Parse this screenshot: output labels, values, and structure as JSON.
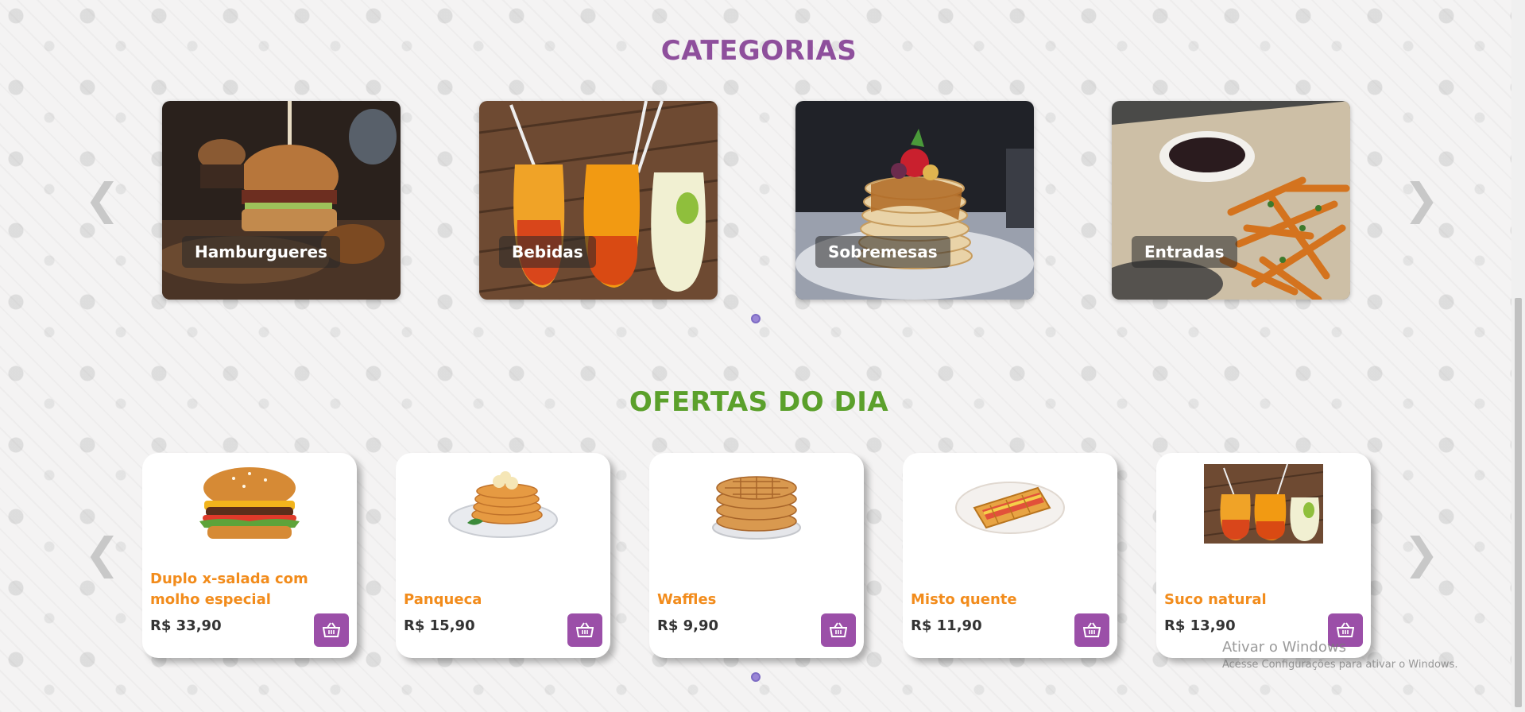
{
  "categories": {
    "title": "CATEGORIAS",
    "items": [
      {
        "label": "Hamburgueres"
      },
      {
        "label": "Bebidas"
      },
      {
        "label": "Sobremesas"
      },
      {
        "label": "Entradas"
      }
    ],
    "prev_arrow": "❮",
    "next_arrow": "❯"
  },
  "offers": {
    "title": "OFERTAS DO DIA",
    "items": [
      {
        "name": "Duplo x-salada com molho especial",
        "price": "R$ 33,90"
      },
      {
        "name": "Panqueca",
        "price": "R$ 15,90"
      },
      {
        "name": "Waffles",
        "price": "R$ 9,90"
      },
      {
        "name": "Misto quente",
        "price": "R$ 11,90"
      },
      {
        "name": "Suco natural",
        "price": "R$ 13,90"
      }
    ],
    "prev_arrow": "❮",
    "next_arrow": "❯"
  },
  "watermark": {
    "line1": "Ativar o Windows",
    "line2": "Acesse Configurações para ativar o Windows."
  },
  "colors": {
    "categories_title": "#8e4f9c",
    "offers_title": "#5ba02b",
    "offer_name": "#f28c1c",
    "cart_button": "#9b4fa8",
    "dot": "#9a86d6"
  },
  "icons": {
    "cart": "basket-icon",
    "prev": "chevron-left-icon",
    "next": "chevron-right-icon"
  }
}
